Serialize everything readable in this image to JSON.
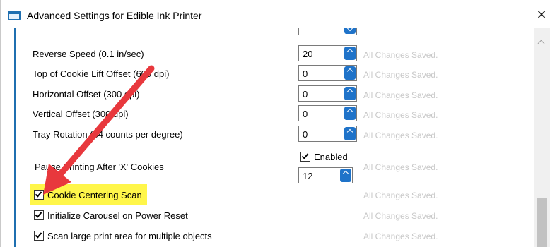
{
  "window": {
    "title": "Advanced Settings for Edible Ink Printer",
    "close_glyph": "×",
    "icon": "window-app-icon"
  },
  "settings": {
    "rows": [
      {
        "label": "",
        "value": "",
        "status": ""
      },
      {
        "label": "Reverse Speed (0.1 in/sec)",
        "value": "20",
        "status": "All Changes Saved."
      },
      {
        "label": "Top of Cookie Lift Offset (600 dpi)",
        "value": "0",
        "status": "All Changes Saved."
      },
      {
        "label": "Horizontal Offset (300 dpi)",
        "value": "0",
        "status": "All Changes Saved."
      },
      {
        "label": "Vertical Offset (300 dpi)",
        "value": "0",
        "status": "All Changes Saved."
      },
      {
        "label": "Tray Rotation (64 counts per degree)",
        "value": "0",
        "status": "All Changes Saved."
      }
    ],
    "pause": {
      "label": "Pause Printing After 'X' Cookies",
      "enabled_label": "Enabled",
      "enabled": true,
      "value": "12",
      "status": "All Changes Saved."
    },
    "checkboxes": [
      {
        "label": "Cookie Centering Scan",
        "checked": true,
        "status": "All Changes Saved.",
        "highlighted": true
      },
      {
        "label": "Initialize Carousel on Power Reset",
        "checked": true,
        "status": "All Changes Saved."
      },
      {
        "label": "Scan large print area for multiple objects",
        "checked": true,
        "status": "All Changes Saved."
      }
    ]
  },
  "colors": {
    "accent": "#1f73c9",
    "status_text": "#c8c8c8",
    "highlight": "#fff64a",
    "annotation_arrow": "#e8383d"
  }
}
